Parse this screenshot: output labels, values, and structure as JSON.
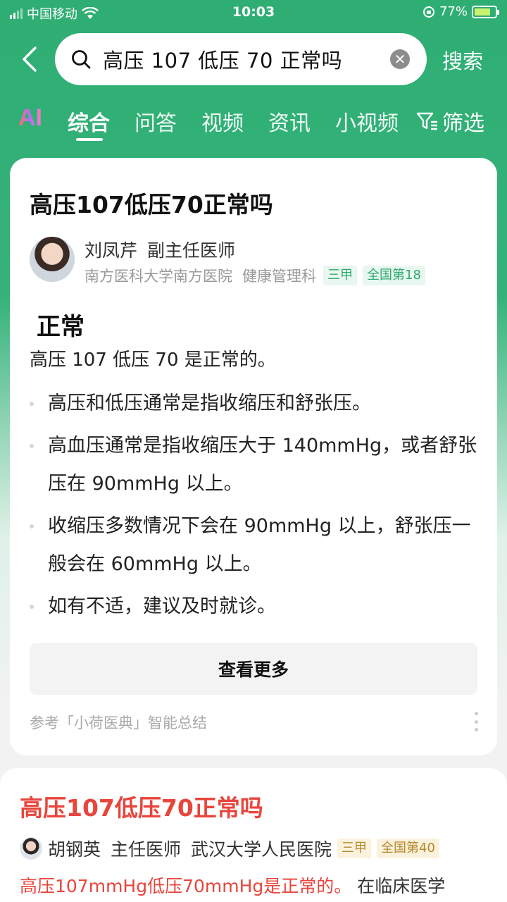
{
  "status": {
    "carrier": "中国移动",
    "time": "10:03",
    "battery": "77%",
    "battery_level": 0.77
  },
  "search": {
    "query": "高压 107 低压 70 正常吗",
    "button": "搜索"
  },
  "tabs": [
    {
      "label": "AI"
    },
    {
      "label": "综合"
    },
    {
      "label": "问答"
    },
    {
      "label": "视频"
    },
    {
      "label": "资讯"
    },
    {
      "label": "小视频"
    },
    {
      "label": "筛选"
    }
  ],
  "card1": {
    "title": "高压107低压70正常吗",
    "doctor": {
      "name": "刘凤芹",
      "title": "副主任医师",
      "hospital": "南方医科大学南方医院",
      "dept": "健康管理科",
      "tag1": "三甲",
      "tag2": "全国第18"
    },
    "answer_head": "正常",
    "summary": "高压 107 低压 70 是正常的。",
    "bullets": [
      "高压和低压通常是指收缩压和舒张压。",
      "高血压通常是指收缩压大于 140mmHg，或者舒张压在 90mmHg 以上。",
      "收缩压多数情况下会在 90mmHg 以上，舒张压一般会在 60mmHg 以上。",
      "如有不适，建议及时就诊。"
    ],
    "more": "查看更多",
    "reference": "参考「小荷医典」智能总结"
  },
  "card2": {
    "title": "高压107低压70正常吗",
    "doctor": {
      "name": "胡钢英",
      "title": "主任医师",
      "hospital": "武汉大学人民医院",
      "tag1": "三甲",
      "tag2": "全国第40"
    },
    "snippet_highlight": "高压107mmHg低压70mmHg是正常的。",
    "snippet_rest": " 在临床医学"
  },
  "colors": {
    "brand_green": "#2fae74",
    "highlight_red": "#e8453c",
    "tag_green": "#2faa6c",
    "tag_gold": "#b48a2a"
  }
}
